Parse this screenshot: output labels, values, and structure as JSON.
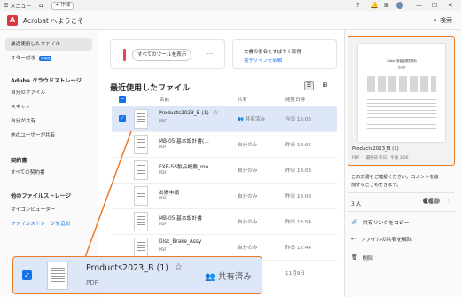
{
  "titlebar": {
    "menu": "メニュー",
    "create": "作成"
  },
  "header": {
    "title": "Acrobat へようこそ",
    "search": "検索"
  },
  "sidebar": {
    "recent": "最近使用したファイル",
    "starred": "スター付き",
    "starred_badge": "新機能",
    "cloud_head": "Adobe クラウドストレージ",
    "my_files": "自分のファイル",
    "scans": "スキャン",
    "shared_by_me": "自分が共有",
    "shared_by_others": "他のユーザーが共有",
    "agreements_head": "契約書",
    "all_agreements": "すべての契約書",
    "other_storage_head": "他のファイルストレージ",
    "my_computer": "マイコンピューター",
    "add_storage": "ファイルストレージを追加"
  },
  "tools_card": {
    "label": "すべてのツールを表示",
    "more": "…"
  },
  "sign_card": {
    "line1": "文書の署名をすばやく取得",
    "line2": "電子サインを依頼"
  },
  "main": {
    "section_title": "最近使用したファイル",
    "col_name": "名前",
    "col_share": "共有",
    "col_opened": "閲覧日時"
  },
  "files": [
    {
      "name": "Products2023_B (1)",
      "type": "PDF",
      "share": "共有済み",
      "date": "今日 15:06",
      "selected": true
    },
    {
      "name": "MB-05l基本設計書(...",
      "type": "PDF",
      "share": "自分のみ",
      "date": "昨日 18:05",
      "selected": false
    },
    {
      "name": "EXR-5S製品概要_mo...",
      "type": "PDF",
      "share": "自分のみ",
      "date": "昨日 18:03",
      "selected": false
    },
    {
      "name": "出張申請",
      "type": "PDF",
      "share": "自分のみ",
      "date": "昨日 13:08",
      "selected": false
    },
    {
      "name": "MB-05l基本設計書",
      "type": "PDF",
      "share": "自分のみ",
      "date": "昨日 12:54",
      "selected": false
    },
    {
      "name": "Disk_Brake_Assy",
      "type": "PDF",
      "share": "自分のみ",
      "date": "昨日 12:44",
      "selected": false
    },
    {
      "name": "",
      "type": "",
      "share": "",
      "date": "11月9日",
      "selected": false
    }
  ],
  "callout": {
    "name": "Products2023_B (1)",
    "type": "PDF",
    "share": "共有済み"
  },
  "right_panel": {
    "file_name": "Products2023_B (1)",
    "meta": "PDF ・ 最終日 今日、午後 3:06",
    "preview_title": "Global 新製品発表資料",
    "preview_subtitle": "企画部",
    "comment_text_1": "この文書をご確認ください。コメントを追",
    "comment_text_2": "加することもできます。",
    "people": "3 人",
    "copy_link": "共有リンクをコピー",
    "unshare": "ファイルの共有を解除",
    "delete": "削除"
  },
  "colors": {
    "accent": "#1473e6",
    "highlight": "#e87a2a",
    "selected_row": "#dde7f7",
    "adobe_red": "#d7373f"
  }
}
